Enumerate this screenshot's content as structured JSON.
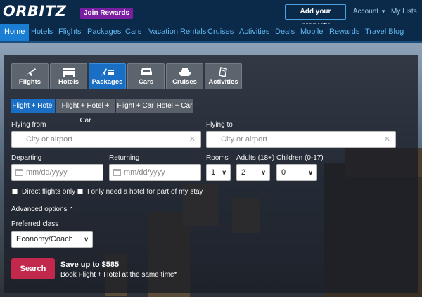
{
  "header": {
    "logo": "RBITZ",
    "logo_prefix": "O",
    "join_rewards": "Join Rewards",
    "add_property": "Add your property",
    "account": "Account",
    "my_lists": "My Lists"
  },
  "nav": {
    "items": [
      "Home",
      "Hotels",
      "Flights",
      "Packages",
      "Cars",
      "Vacation Rentals",
      "Cruises",
      "Activities",
      "Deals",
      "Mobile",
      "Rewards",
      "Travel Blog"
    ],
    "active": "Home"
  },
  "product_tabs": [
    {
      "label": "Flights",
      "icon": "plane-icon"
    },
    {
      "label": "Hotels",
      "icon": "bed-icon"
    },
    {
      "label": "Packages",
      "icon": "plane-bed-icon"
    },
    {
      "label": "Cars",
      "icon": "car-icon"
    },
    {
      "label": "Cruises",
      "icon": "ship-icon"
    },
    {
      "label": "Activities",
      "icon": "ticket-icon"
    }
  ],
  "package_types": [
    "Flight + Hotel",
    "Flight + Hotel + Car",
    "Flight + Car",
    "Hotel + Car"
  ],
  "form": {
    "flying_from_label": "Flying from",
    "flying_from_placeholder": "City or airport",
    "flying_to_label": "Flying to",
    "flying_to_placeholder": "City or airport",
    "departing_label": "Departing",
    "departing_placeholder": "mm/dd/yyyy",
    "returning_label": "Returning",
    "returning_placeholder": "mm/dd/yyyy",
    "rooms_label": "Rooms",
    "rooms_value": "1",
    "adults_label": "Adults (18+)",
    "adults_value": "2",
    "children_label": "Children (0-17)",
    "children_value": "0",
    "direct_flights": "Direct flights only",
    "partial_hotel": "I only need a hotel for part of my stay",
    "advanced_options": "Advanced options",
    "preferred_class_label": "Preferred class",
    "preferred_class_value": "Economy/Coach",
    "search_button": "Search",
    "save_line1": "Save up to $585",
    "save_line2": "Book Flight + Hotel at the same time*"
  },
  "colors": {
    "header_bg": "#0b2a4a",
    "nav_active": "#1a7fd4",
    "tab_active": "#1a6fc4",
    "join_rewards": "#7a1fa2",
    "search_button": "#c2284b"
  }
}
